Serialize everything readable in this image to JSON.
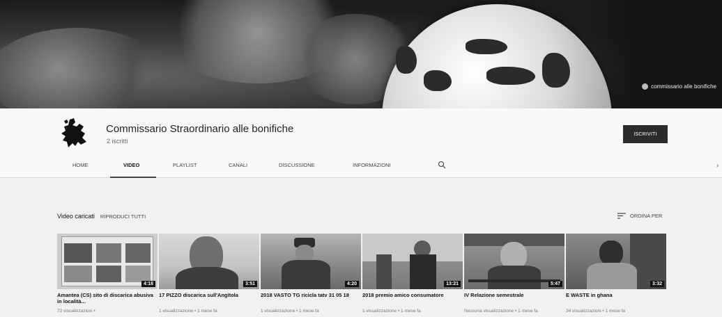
{
  "banner": {
    "label": "commissario alle bonifiche"
  },
  "channel": {
    "title": "Commissario Straordinario alle bonifiche",
    "subscribers": "2 iscritti",
    "subscribe_label": "ISCRIVITI"
  },
  "tabs": [
    {
      "label": "HOME"
    },
    {
      "label": "VIDEO"
    },
    {
      "label": "PLAYLIST"
    },
    {
      "label": "CANALI"
    },
    {
      "label": "DISCUSSIONE"
    },
    {
      "label": "INFORMAZIONI"
    }
  ],
  "section": {
    "title": "Video caricati",
    "play_all": "RIPRODUCI TUTTI",
    "sort_label": "ORDINA PER"
  },
  "videos": [
    {
      "title": "Amantea (CS) sito di discarica abusiva in località...",
      "duration": "4:18",
      "meta": "72 visualizzazioni •"
    },
    {
      "title": "17 PIZZO discarica sull'Angitola",
      "duration": "3:51",
      "meta": "1 visualizzazione • 1 mese fa"
    },
    {
      "title": "2018 VASTO TG ricicla tatv 31 05 18",
      "duration": "4:20",
      "meta": "1 visualizzazione • 1 mese fa"
    },
    {
      "title": "2018 premio amico consumatore",
      "duration": "13:21",
      "meta": "1 visualizzazione • 1 mese fa"
    },
    {
      "title": "IV Relazione semestrale",
      "duration": "5:47",
      "meta": "Nessuna visualizzazione • 1 mese fa"
    },
    {
      "title": "E WASTE in ghana",
      "duration": "3:32",
      "meta": "34 visualizzazioni • 1 mese fa"
    }
  ],
  "colors": {
    "subscribe_bg": "#2b2b2b",
    "page_bg": "#f1f1f1"
  }
}
